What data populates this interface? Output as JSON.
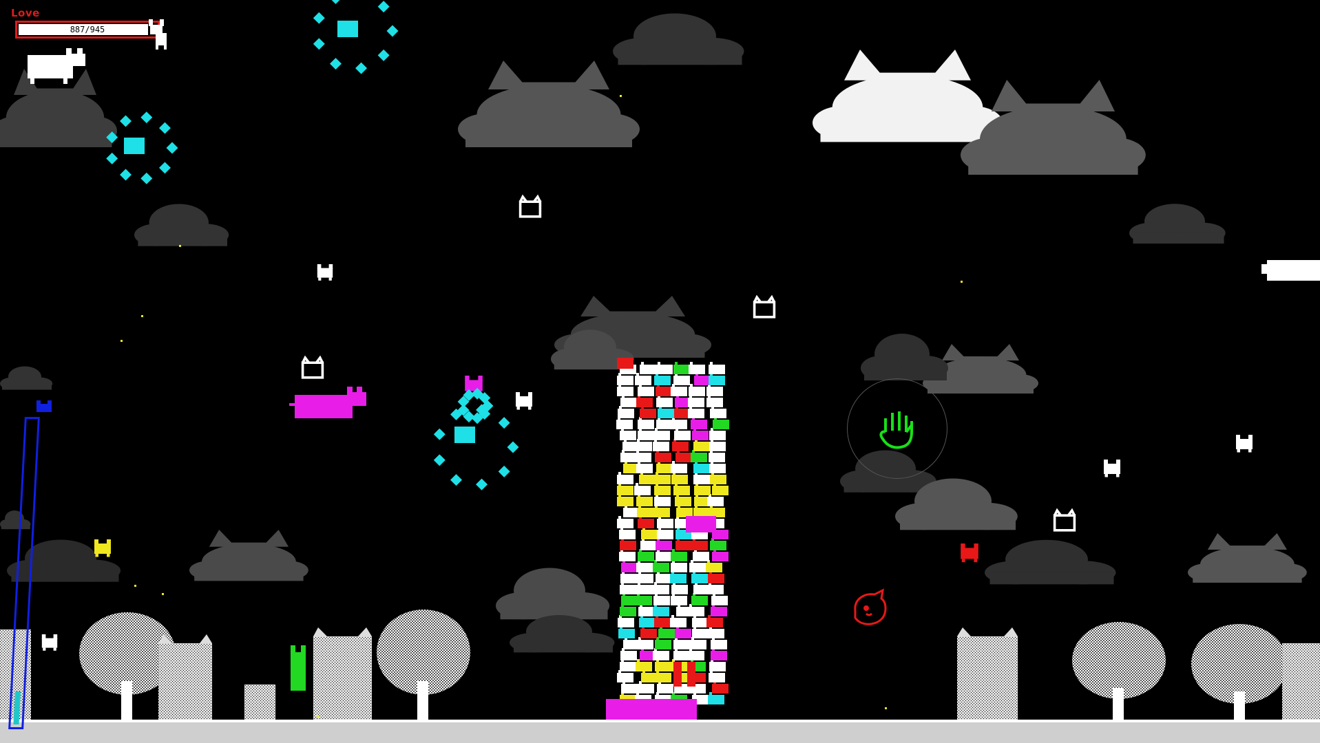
{
  "hud": {
    "love_label": "Love",
    "love_value": "887/945",
    "love_fraction": 0.9386,
    "meter_fraction": 0.11
  },
  "colors": {
    "background": "#000000",
    "love_red": "#e01a1a",
    "cloud_dark": "#3d3d3d",
    "cloud_mid": "#5a5a5a",
    "cloud_white": "#f2f2f2",
    "meter_blue": "#1020e0",
    "meter_fill": "#1ec8c8",
    "cursor_green": "#18e018",
    "cyan": "#1ee0e6",
    "magenta": "#e81ee8",
    "yellow": "#f0e81e",
    "green": "#22d822",
    "red": "#e81818",
    "white": "#ffffff"
  },
  "icons": {
    "grab_cursor": "open-hand-icon",
    "love_cat": "cat-icon",
    "meter_top": "blue-cat-head-icon"
  }
}
